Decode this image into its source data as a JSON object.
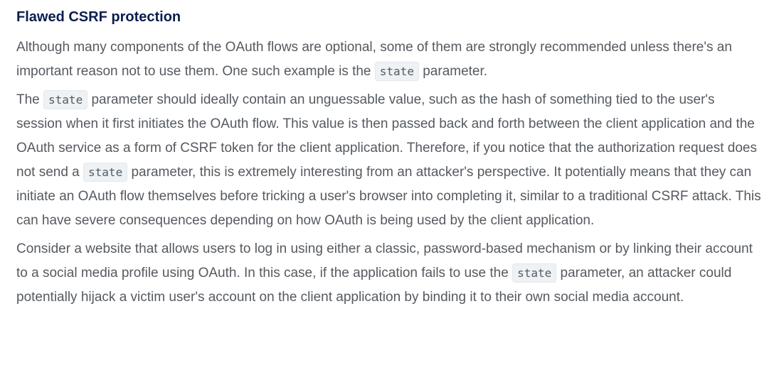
{
  "section": {
    "heading": "Flawed CSRF protection",
    "p1": {
      "t1": "Although many components of the OAuth flows are optional, some of them are strongly recommended unless there's an important reason not to use them. One such example is the ",
      "code1": "state",
      "t2": " parameter."
    },
    "p2": {
      "t1": "The ",
      "code1": "state",
      "t2": " parameter should ideally contain an unguessable value, such as the hash of something tied to the user's session when it first initiates the OAuth flow. This value is then passed back and forth between the client application and the OAuth service as a form of CSRF token for the client application. Therefore, if you notice that the authorization request does not send a ",
      "code2": "state",
      "t3": " parameter, this is extremely interesting from an attacker's perspective. It potentially means that they can initiate an OAuth flow themselves before tricking a user's browser into completing it, similar to a traditional CSRF attack. This can have severe consequences depending on how OAuth is being used by the client application."
    },
    "p3": {
      "t1": "Consider a website that allows users to log in using either a classic, password-based mechanism or by linking their account to a social media profile using OAuth. In this case, if the application fails to use the ",
      "code1": "state",
      "t2": " parameter, an attacker could potentially hijack a victim user's account on the client application by binding it to their own social media account."
    }
  },
  "colors": {
    "heading": "#0a1e4f",
    "body_text": "#555a60",
    "code_background": "#eef2f5"
  }
}
